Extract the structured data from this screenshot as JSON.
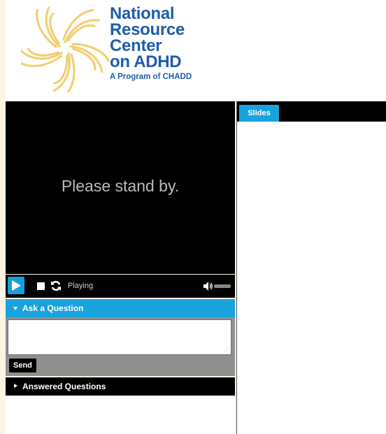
{
  "logo": {
    "line1": "National",
    "line2": "Resource",
    "line3": "Center",
    "line4": "on ADHD",
    "tagline": "A Program of CHADD",
    "brand_color": "#1f5ea8",
    "mark_color": "#f2cf74"
  },
  "player": {
    "message": "Please stand by.",
    "status": "Playing",
    "icons": [
      "play-icon",
      "stop-icon",
      "refresh-icon",
      "volume-icon"
    ]
  },
  "ask": {
    "header": "Ask a Question",
    "input_value": "",
    "send_label": "Send"
  },
  "answered": {
    "header": "Answered Questions"
  },
  "slides": {
    "tab_label": "Slides"
  },
  "colors": {
    "accent": "#19a3dd",
    "background": "#fdf2e3"
  }
}
